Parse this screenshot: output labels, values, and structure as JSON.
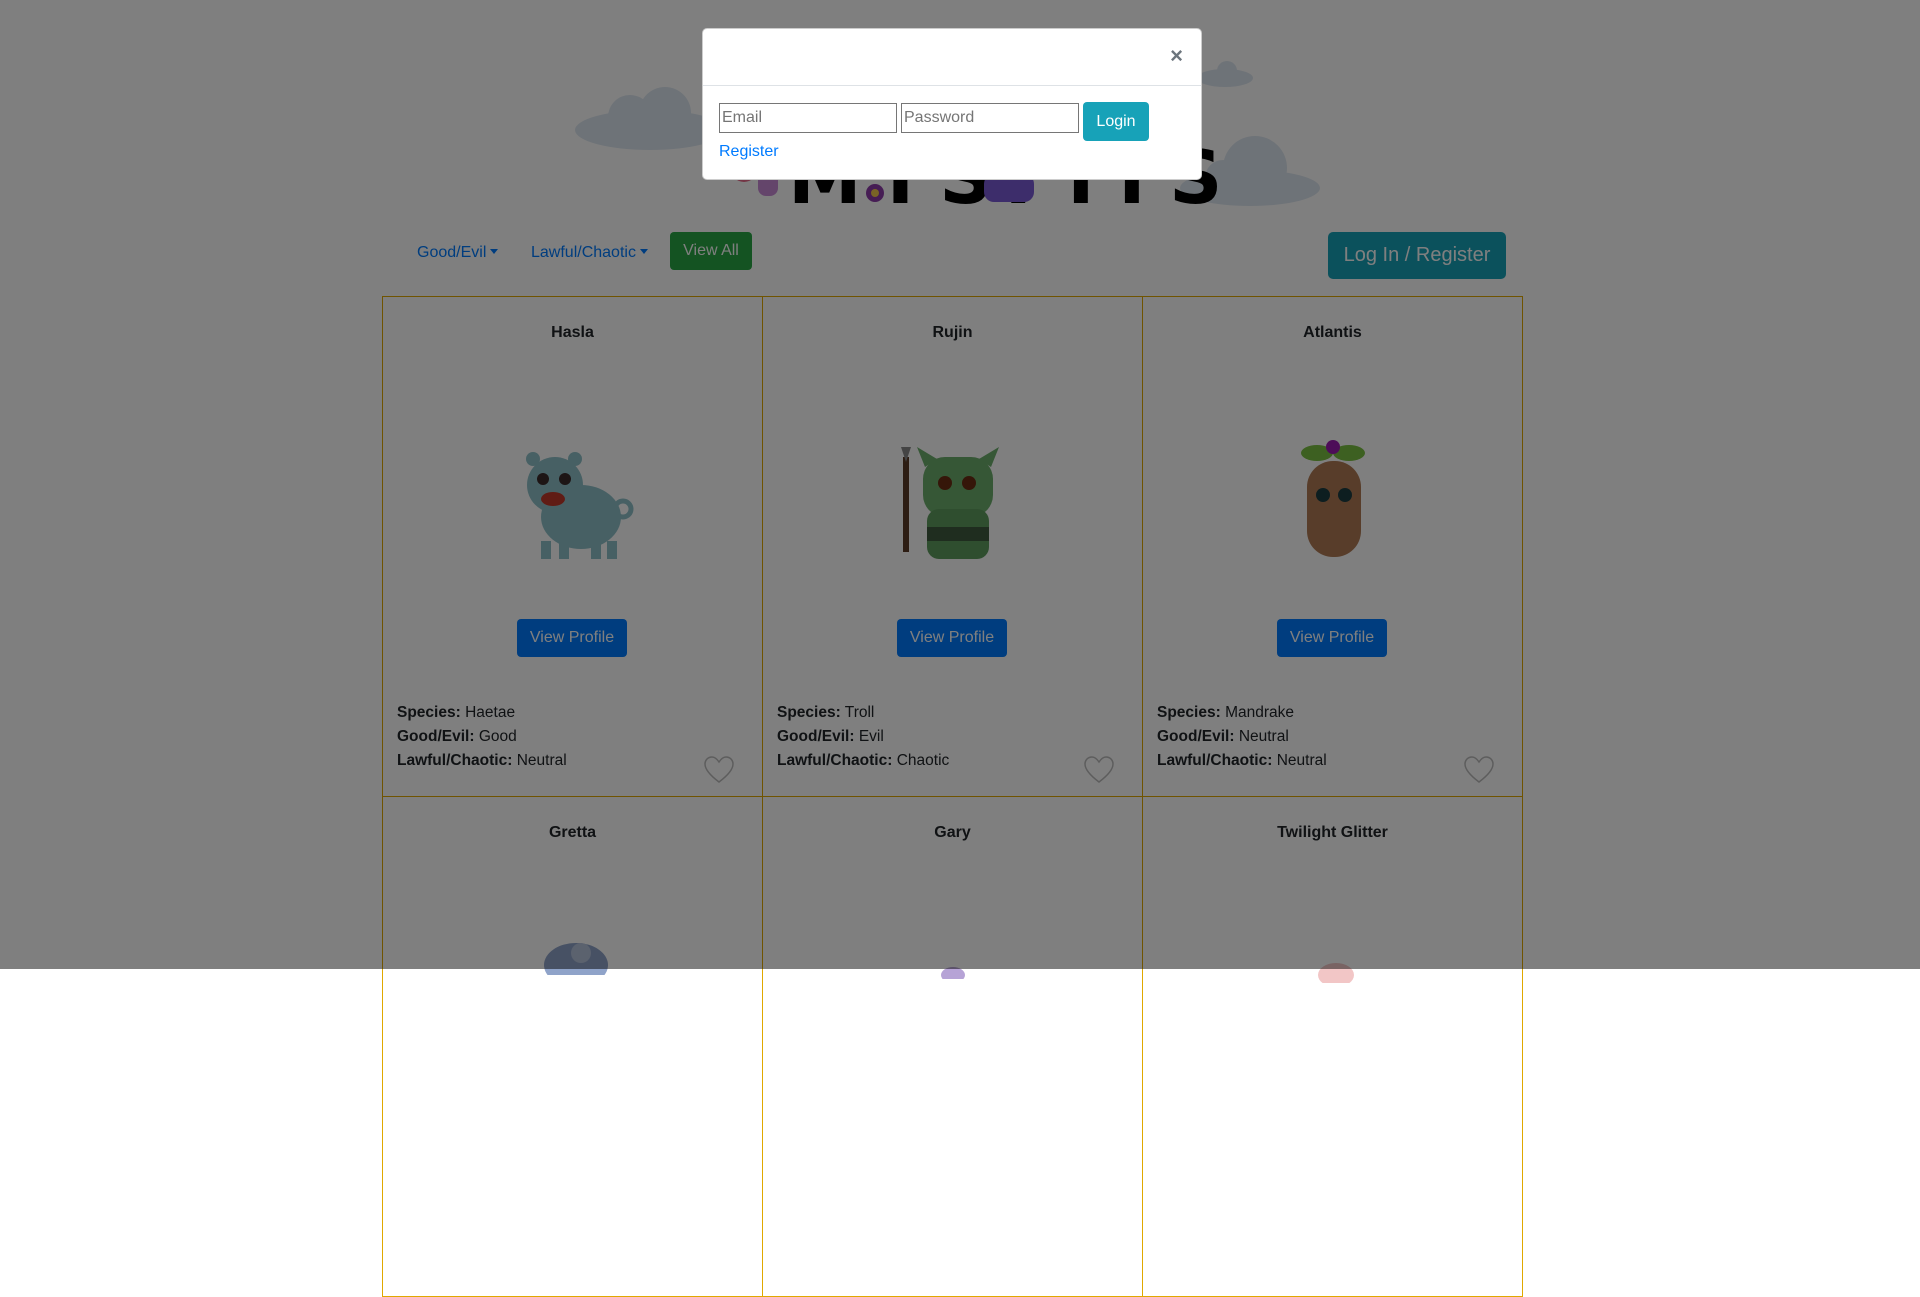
{
  "header": {
    "logo_text": "MYSFITS"
  },
  "nav": {
    "good_evil_label": "Good/Evil",
    "lawful_chaotic_label": "Lawful/Chaotic",
    "view_all_label": "View All",
    "login_register_label": "Log In / Register"
  },
  "field_labels": {
    "species": "Species:",
    "good_evil": "Good/Evil:",
    "lawful_chaotic": "Lawful/Chaotic:"
  },
  "cards": [
    {
      "name": "Hasla",
      "button": "View Profile",
      "species": "Haetae",
      "good_evil": "Good",
      "lawful_chaotic": "Neutral"
    },
    {
      "name": "Rujin",
      "button": "View Profile",
      "species": "Troll",
      "good_evil": "Evil",
      "lawful_chaotic": "Chaotic"
    },
    {
      "name": "Atlantis",
      "button": "View Profile",
      "species": "Mandrake",
      "good_evil": "Neutral",
      "lawful_chaotic": "Neutral"
    },
    {
      "name": "Gretta"
    },
    {
      "name": "Gary"
    },
    {
      "name": "Twilight Glitter"
    }
  ],
  "modal": {
    "close_label": "×",
    "email_placeholder": "Email",
    "password_placeholder": "Password",
    "login_label": "Login",
    "register_label": "Register"
  },
  "colors": {
    "card_border": "#e0a800",
    "primary": "#007bff",
    "success": "#28a745",
    "info": "#17a2b8"
  }
}
